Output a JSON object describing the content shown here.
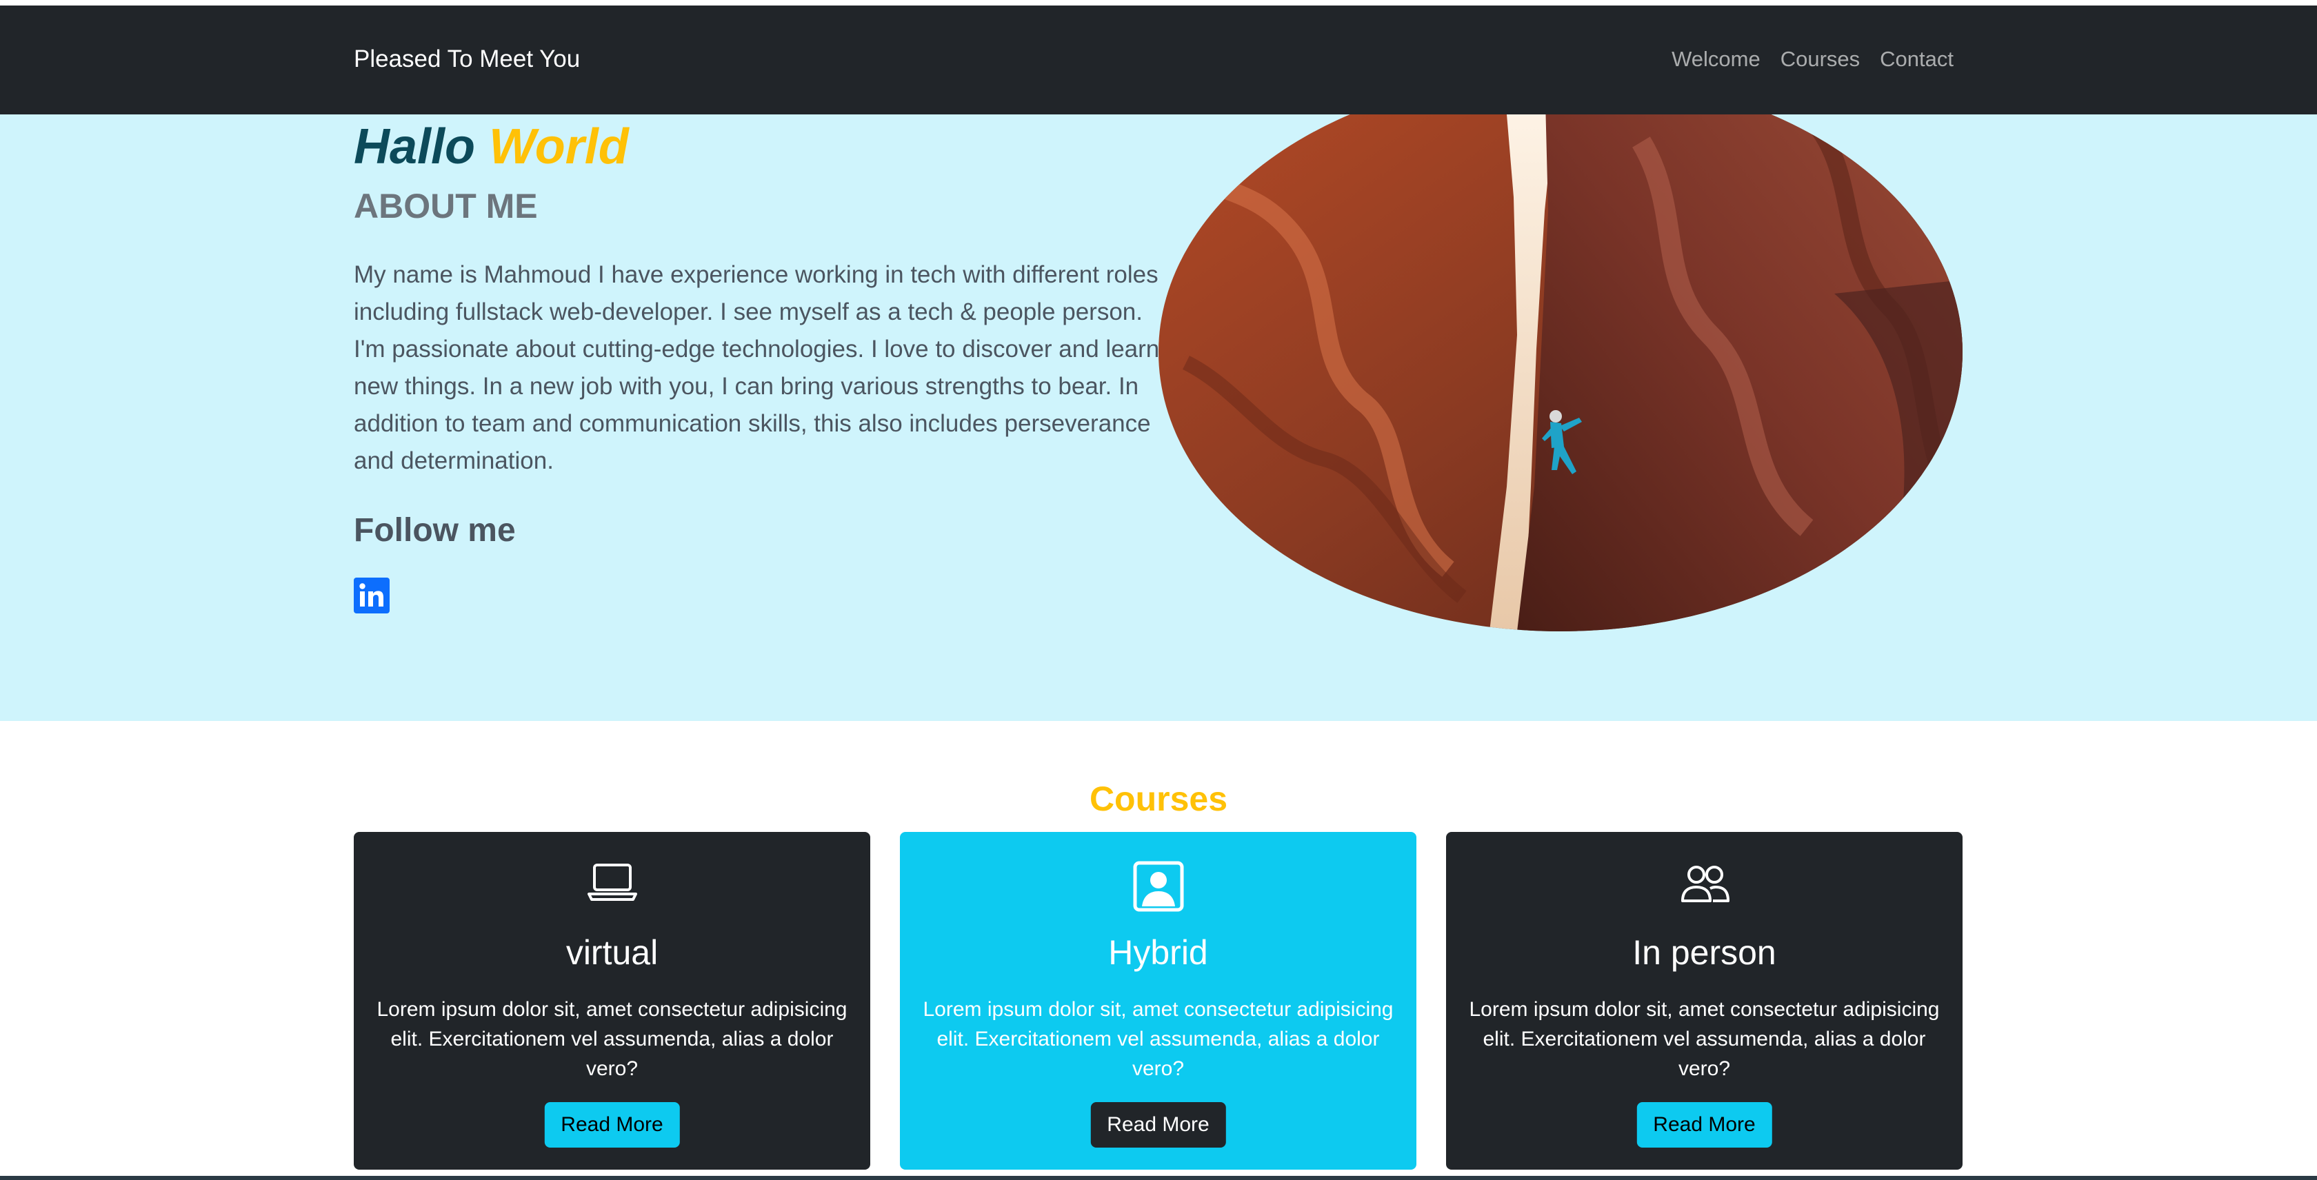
{
  "navbar": {
    "brand": "Pleased To Meet You",
    "links": [
      "Welcome",
      "Courses",
      "Contact"
    ]
  },
  "hero": {
    "title_part1": "Hallo",
    "title_part2": "World",
    "about_heading": "ABOUT ME",
    "about_text": "My name is Mahmoud I have experience working in tech with different roles including fullstack web-developer. I see myself as a tech & people person. I'm passionate about cutting-edge technologies. I love to discover and learn new things. In a new job with you, I can bring various strengths to bear. In addition to team and communication skills, this also includes perseverance and determination.",
    "follow_heading": "Follow me",
    "social_icon": "linkedin-icon",
    "image": "canyon-climber-photo"
  },
  "courses": {
    "title": "Courses",
    "cards": [
      {
        "icon": "laptop-icon",
        "title": "virtual",
        "text": "Lorem ipsum dolor sit, amet consectetur adipisicing elit. Exercitationem vel assumenda, alias a dolor vero?",
        "button": "Read More",
        "style": "dark"
      },
      {
        "icon": "person-square-icon",
        "title": "Hybrid",
        "text": "Lorem ipsum dolor sit, amet consectetur adipisicing elit. Exercitationem vel assumenda, alias a dolor vero?",
        "button": "Read More",
        "style": "info"
      },
      {
        "icon": "people-icon",
        "title": "In person",
        "text": "Lorem ipsum dolor sit, amet consectetur adipisicing elit. Exercitationem vel assumenda, alias a dolor vero?",
        "button": "Read More",
        "style": "dark"
      }
    ]
  },
  "colors": {
    "navbar_bg": "#212529",
    "hero_bg": "#cff4fc",
    "accent_yellow": "#ffc107",
    "accent_cyan": "#0dcaf0",
    "title_teal": "#0c4a5a"
  }
}
